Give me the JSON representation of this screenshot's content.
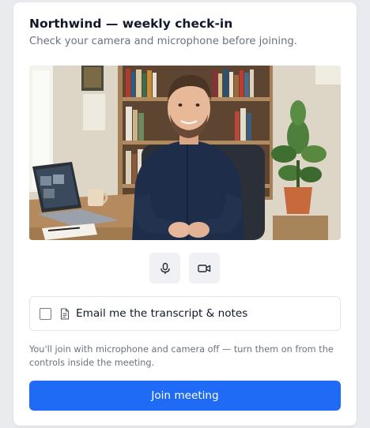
{
  "dialog": {
    "title": "Northwind — weekly check-in",
    "subtitle": "Check your camera and microphone before joining."
  },
  "preview": {
    "description": "camera-preview-image"
  },
  "controls": [
    {
      "name": "microphone-button",
      "icon": "microphone-icon"
    },
    {
      "name": "camera-button",
      "icon": "video-camera-icon"
    }
  ],
  "option": {
    "label": "Email me the transcript & notes",
    "checked": false,
    "icon": "document-icon"
  },
  "note": "You'll join with microphone and camera off — turn them on from the controls inside the meeting.",
  "join_label": "Join meeting",
  "colors": {
    "primary": "#1f6bf5",
    "page_bg": "#e9ebef",
    "control_bg": "#f0f1f4",
    "muted_text": "#6b7280"
  }
}
